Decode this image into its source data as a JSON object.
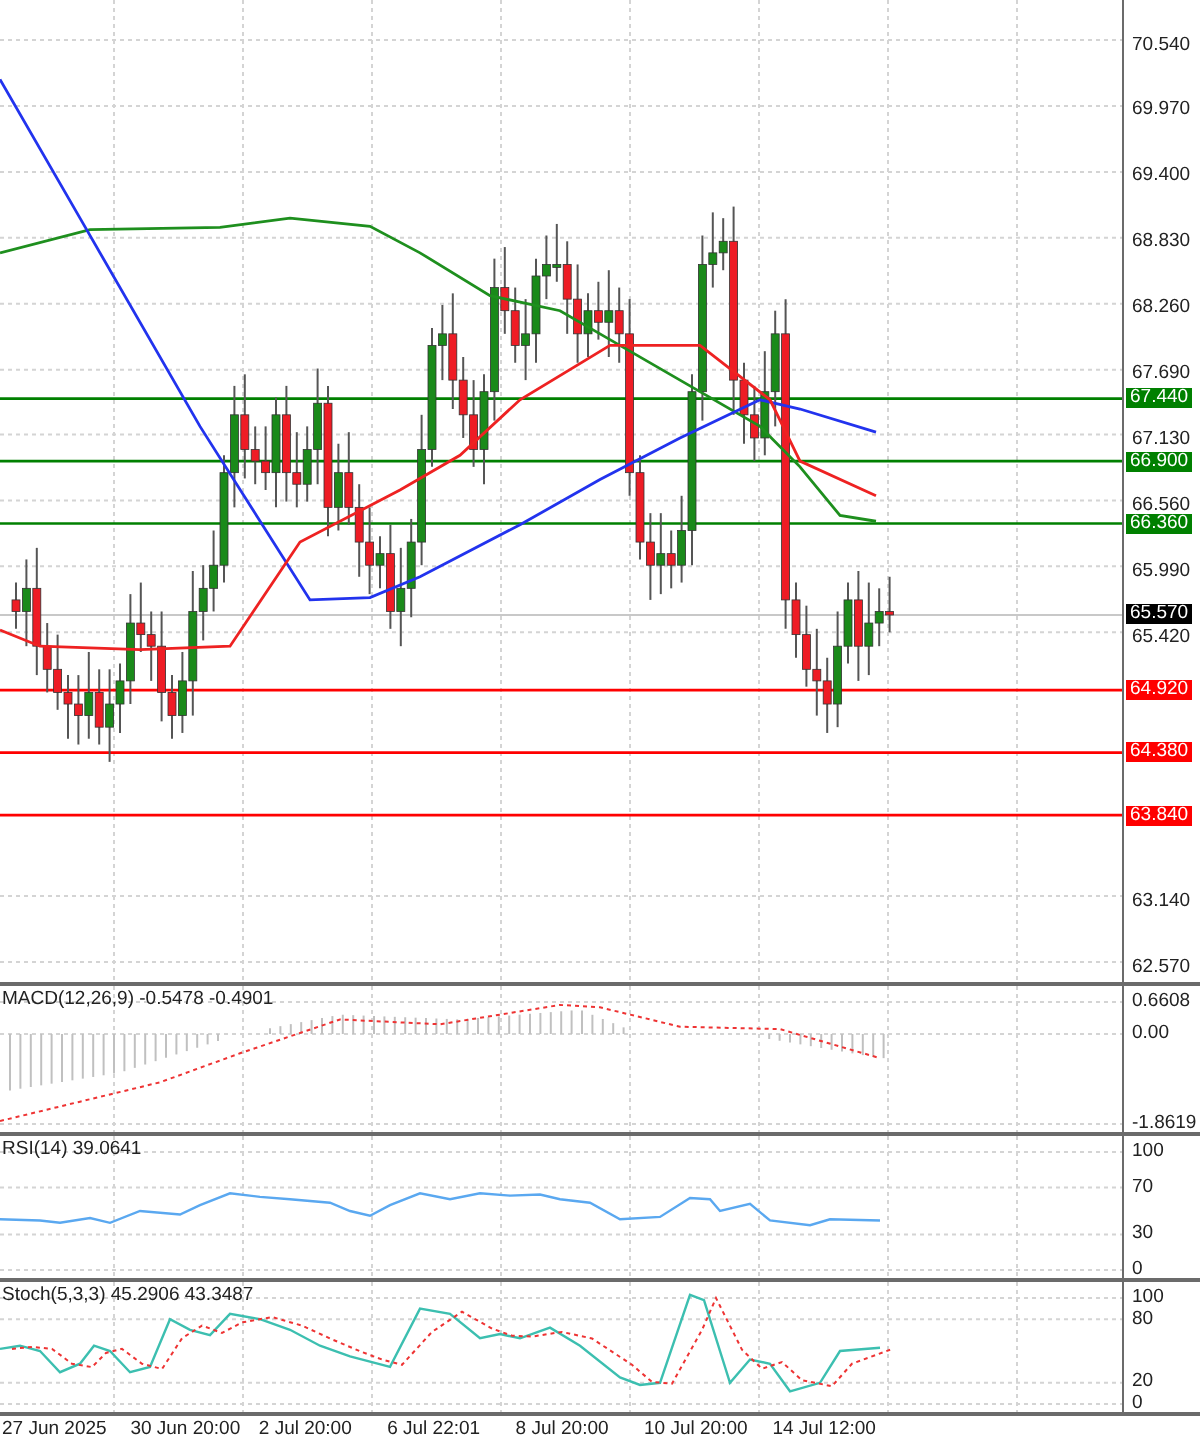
{
  "main_chart": {
    "price_axis": [
      "70.540",
      "69.970",
      "69.400",
      "68.830",
      "68.260",
      "67.690",
      "67.130",
      "66.560",
      "65.990",
      "65.420",
      "63.140",
      "62.570"
    ],
    "levels": [
      {
        "label": "67.440",
        "kind": "line",
        "color": "#008000"
      },
      {
        "label": "66.900",
        "kind": "line",
        "color": "#008000"
      },
      {
        "label": "66.360",
        "kind": "line",
        "color": "#008000"
      },
      {
        "label": "65.570",
        "kind": "current",
        "color": "#000000"
      },
      {
        "label": "64.920",
        "kind": "line",
        "color": "#ff0000"
      },
      {
        "label": "64.380",
        "kind": "line",
        "color": "#ff0000"
      },
      {
        "label": "63.840",
        "kind": "line",
        "color": "#ff0000"
      }
    ]
  },
  "indicators": [
    {
      "kind": "macd",
      "title": "MACD(12,26,9) -0.5478 -0.4901",
      "axis": [
        "0.6608",
        "0.00",
        "-1.8619"
      ]
    },
    {
      "kind": "rsi",
      "title": "RSI(14) 39.0641",
      "axis": [
        "100",
        "70",
        "30",
        "0"
      ]
    },
    {
      "kind": "stoch",
      "title": "Stoch(5,3,3) 45.2906 43.3487",
      "axis": [
        "100",
        "80",
        "20",
        "0"
      ]
    }
  ],
  "time_axis": [
    "27 Jun 2025",
    "30 Jun 20:00",
    "2 Jul 20:00",
    "6 Jul 22:01",
    "8 Jul 20:00",
    "10 Jul 20:00",
    "14 Jul 12:00"
  ]
}
